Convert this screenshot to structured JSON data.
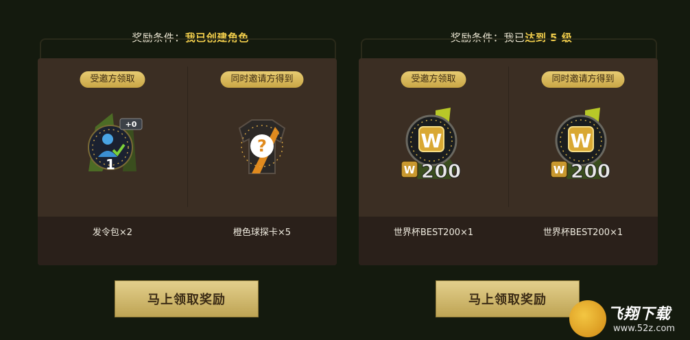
{
  "panels": [
    {
      "condition_prefix": "奖励条件：",
      "condition_highlight": "我已创建角色",
      "condition_suffix": "",
      "slots": [
        {
          "badge": "受邀方领取",
          "icon": "trophy-medal-icon",
          "overlay_tag": "+0",
          "item_name": "发令包×2"
        },
        {
          "badge": "同时邀请方得到",
          "icon": "mystery-jersey-icon",
          "item_name": "橙色球探卡×5"
        }
      ],
      "button_label": "马上领取奖励"
    },
    {
      "condition_prefix": "奖励条件：我已",
      "condition_highlight": "达到 5 级",
      "condition_suffix": "",
      "slots": [
        {
          "badge": "受邀方领取",
          "icon": "w200-badge-icon",
          "item_name": "世界杯BEST200×1"
        },
        {
          "badge": "同时邀请方得到",
          "icon": "w200-badge-icon",
          "item_name": "世界杯BEST200×1"
        }
      ],
      "button_label": "马上领取奖励"
    }
  ],
  "watermark": {
    "brand": "飞翔下载",
    "url": "www.52z.com"
  },
  "colors": {
    "background": "#141a0e",
    "card": "#3b2e23",
    "highlight": "#f3cf4c",
    "button": "#d6c07a"
  }
}
